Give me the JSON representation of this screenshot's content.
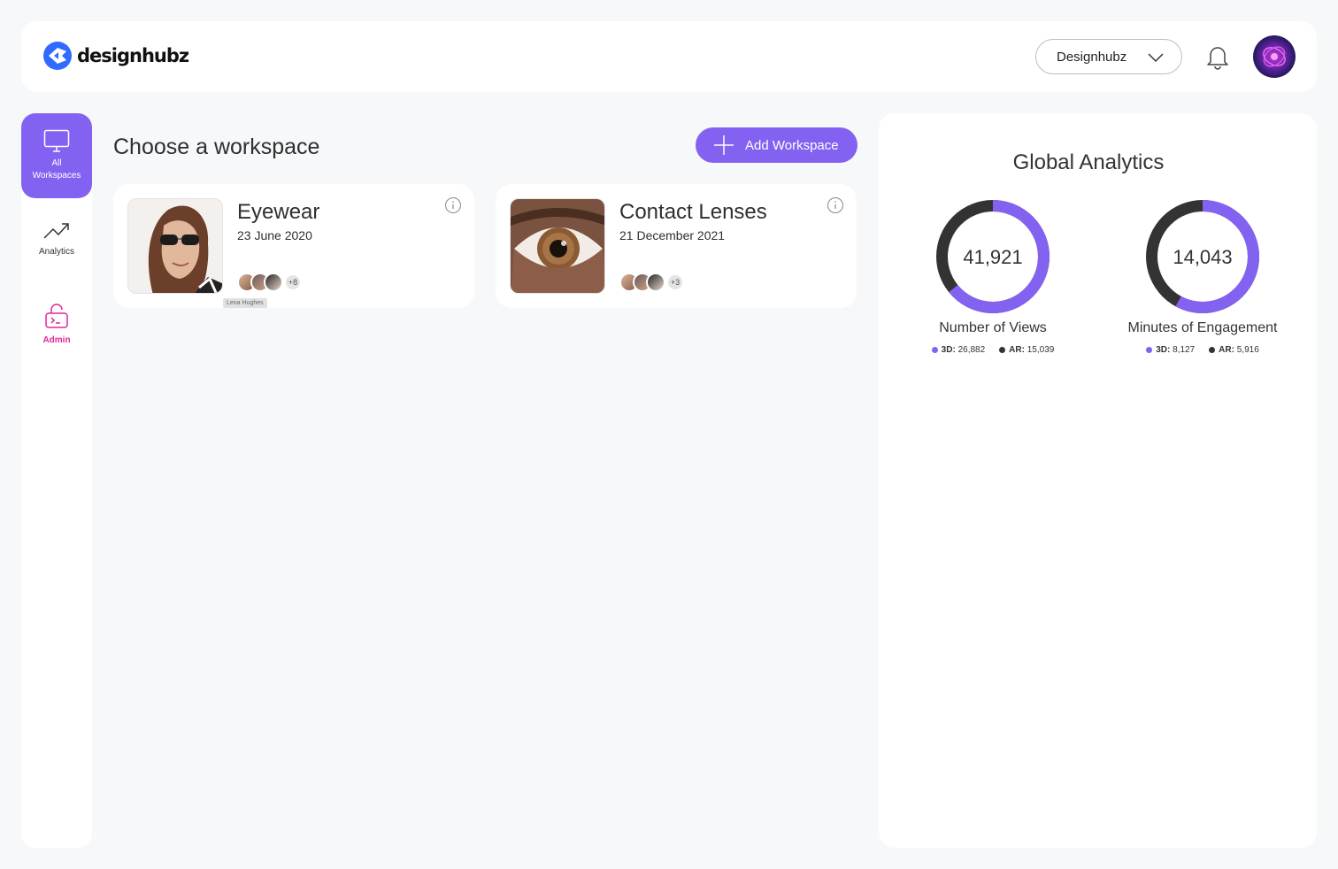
{
  "brand": {
    "name": "designhubz"
  },
  "header": {
    "workspace_select": "Designhubz"
  },
  "sidebar": {
    "items": [
      {
        "label_line1": "All",
        "label_line2": "Workspaces"
      },
      {
        "label": "Analytics"
      },
      {
        "label": "Admin"
      }
    ]
  },
  "main": {
    "title": "Choose a workspace",
    "add_label": "Add Workspace",
    "cards": [
      {
        "title": "Eyewear",
        "date": "23 June 2020",
        "more": "+8",
        "tooltip": "Lena Hughes"
      },
      {
        "title": "Contact Lenses",
        "date": "21 December 2021",
        "more": "+3"
      }
    ]
  },
  "analytics": {
    "title": "Global Analytics",
    "charts": [
      {
        "total": "41,921",
        "label": "Number of Views",
        "legend": [
          {
            "key": "3D:",
            "value": "26,882"
          },
          {
            "key": "AR:",
            "value": "15,039"
          }
        ]
      },
      {
        "total": "14,043",
        "label": "Minutes of Engagement",
        "legend": [
          {
            "key": "3D:",
            "value": "8,127"
          },
          {
            "key": "AR:",
            "value": "5,916"
          }
        ]
      }
    ]
  },
  "colors": {
    "accent": "#8362f1",
    "dark": "#2f2f2f",
    "admin": "#e1279b"
  },
  "chart_data": [
    {
      "type": "pie",
      "categories": [
        "3D",
        "AR"
      ],
      "values": [
        26882,
        15039
      ],
      "title": "Number of Views"
    },
    {
      "type": "pie",
      "categories": [
        "3D",
        "AR"
      ],
      "values": [
        8127,
        5916
      ],
      "title": "Minutes of Engagement"
    }
  ]
}
